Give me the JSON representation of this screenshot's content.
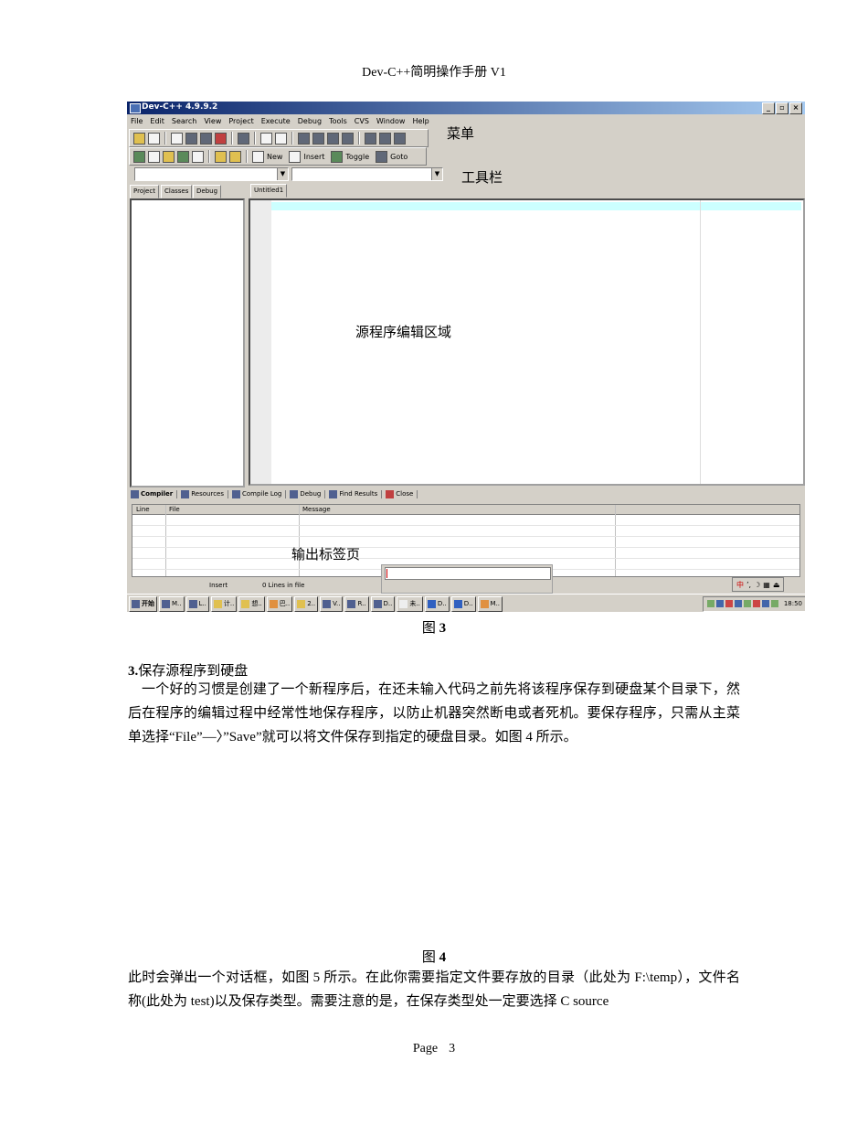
{
  "header": {
    "title": "Dev-C++简明操作手册 V1"
  },
  "screenshot": {
    "window_title": "Dev-C++ 4.9.9.2",
    "window_buttons": [
      "_",
      "▫",
      "×"
    ],
    "menu": [
      "File",
      "Edit",
      "Search",
      "View",
      "Project",
      "Execute",
      "Debug",
      "Tools",
      "CVS",
      "Window",
      "Help"
    ],
    "toolbar_buttons": {
      "new": "New",
      "insert": "Insert",
      "toggle": "Toggle",
      "goto": "Goto"
    },
    "left_tabs": [
      "Project",
      "Classes",
      "Debug"
    ],
    "editor_tab": "Untitled1",
    "bottom_tabs": [
      "Compiler",
      "Resources",
      "Compile Log",
      "Debug",
      "Find Results",
      "Close"
    ],
    "output_columns": [
      "Line",
      "File",
      "Message"
    ],
    "status": {
      "mode": "Insert",
      "lines": "0 Lines in file"
    },
    "taskbar": {
      "start": "开始",
      "buttons": [
        "M..",
        "L..",
        "计..",
        "想..",
        "巴..",
        "2..",
        "V..",
        "R..",
        "D..",
        "未..",
        "D..",
        "D..",
        "M.."
      ],
      "clock": "18:50"
    },
    "annotations": {
      "menu": "菜单",
      "toolbar": "工具栏",
      "editor": "源程序编辑区域",
      "output": "输出标签页"
    }
  },
  "fig3_caption": {
    "prefix": "图 ",
    "num": "3"
  },
  "section3": {
    "num": "3.",
    "title": "保存源程序到硬盘",
    "body": "一个好的习惯是创建了一个新程序后，在还未输入代码之前先将该程序保存到硬盘某个目录下，然后在程序的编辑过程中经常性地保存程序，以防止机器突然断电或者死机。要保存程序，只需从主菜单选择“File”—〉”Save”就可以将文件保存到指定的硬盘目录。如图 4 所示。"
  },
  "fig4_caption": {
    "prefix": "图 ",
    "num": "4"
  },
  "para2": "此时会弹出一个对话框，如图 5 所示。在此你需要指定文件要存放的目录（此处为 F:\\temp），文件名称(此处为  test)以及保存类型。需要注意的是，在保存类型处一定要选择  C  source",
  "footer": {
    "label": "Page",
    "num": "3"
  }
}
